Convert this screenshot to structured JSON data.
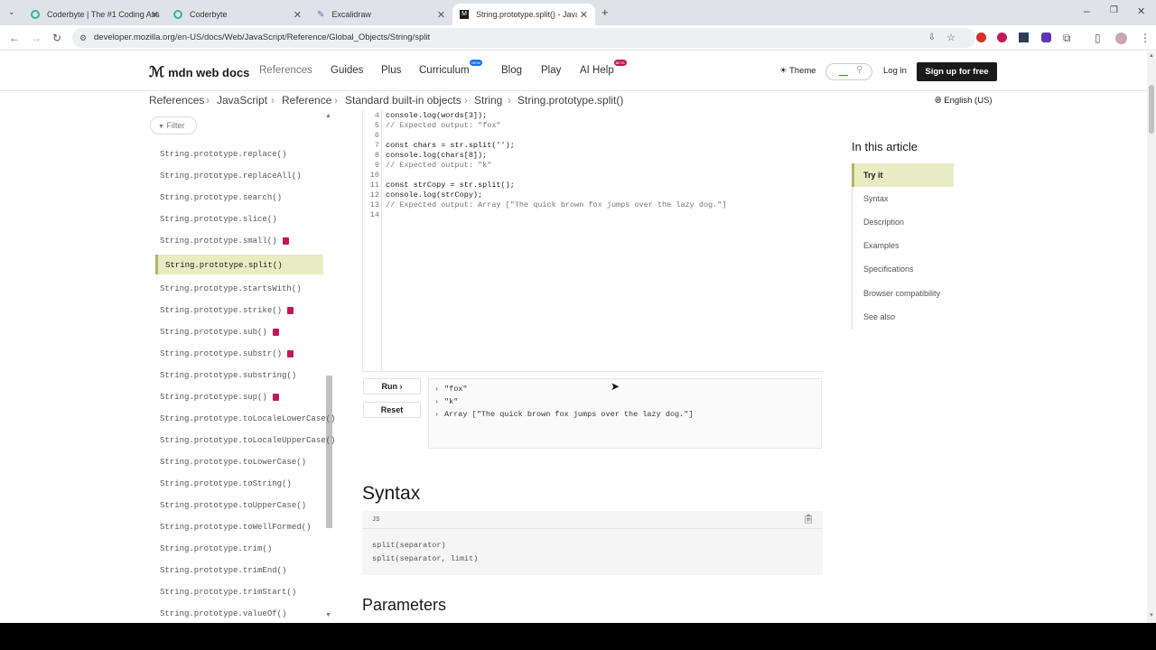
{
  "browser": {
    "tabs": [
      {
        "title": "Coderbyte | The #1 Coding Ass",
        "active": false
      },
      {
        "title": "Coderbyte",
        "active": false
      },
      {
        "title": "Excalidraw",
        "active": false
      },
      {
        "title": "String.prototype.split() - JavaSc",
        "active": true
      }
    ],
    "url": "developer.mozilla.org/en-US/docs/Web/JavaScript/Reference/Global_Objects/String/split"
  },
  "header": {
    "logo": "mdn web docs",
    "nav": [
      "References",
      "Guides",
      "Plus",
      "Curriculum",
      "Blog",
      "Play",
      "AI Help"
    ],
    "curriculum_badge": "NEW",
    "ai_badge": "BETA",
    "theme": "Theme",
    "login": "Log in",
    "signup": "Sign up for free"
  },
  "breadcrumbs": [
    "References",
    "JavaScript",
    "Reference",
    "Standard built-in objects",
    "String",
    "String.prototype.split()"
  ],
  "language": "English (US)",
  "sidebar": {
    "filter": "Filter",
    "items": [
      {
        "label": "String.prototype.replace()",
        "deprecated": false,
        "active": false
      },
      {
        "label": "String.prototype.replaceAll()",
        "deprecated": false,
        "active": false
      },
      {
        "label": "String.prototype.search()",
        "deprecated": false,
        "active": false
      },
      {
        "label": "String.prototype.slice()",
        "deprecated": false,
        "active": false
      },
      {
        "label": "String.prototype.small()",
        "deprecated": true,
        "active": false
      },
      {
        "label": "String.prototype.split()",
        "deprecated": false,
        "active": true
      },
      {
        "label": "String.prototype.startsWith()",
        "deprecated": false,
        "active": false
      },
      {
        "label": "String.prototype.strike()",
        "deprecated": true,
        "active": false
      },
      {
        "label": "String.prototype.sub()",
        "deprecated": true,
        "active": false
      },
      {
        "label": "String.prototype.substr()",
        "deprecated": true,
        "active": false
      },
      {
        "label": "String.prototype.substring()",
        "deprecated": false,
        "active": false
      },
      {
        "label": "String.prototype.sup()",
        "deprecated": true,
        "active": false
      },
      {
        "label": "String.prototype.toLocaleLowerCase()",
        "deprecated": false,
        "active": false
      },
      {
        "label": "String.prototype.toLocaleUpperCase()",
        "deprecated": false,
        "active": false
      },
      {
        "label": "String.prototype.toLowerCase()",
        "deprecated": false,
        "active": false
      },
      {
        "label": "String.prototype.toString()",
        "deprecated": false,
        "active": false
      },
      {
        "label": "String.prototype.toUpperCase()",
        "deprecated": false,
        "active": false
      },
      {
        "label": "String.prototype.toWellFormed()",
        "deprecated": false,
        "active": false
      },
      {
        "label": "String.prototype.trim()",
        "deprecated": false,
        "active": false
      },
      {
        "label": "String.prototype.trimEnd()",
        "deprecated": false,
        "active": false
      },
      {
        "label": "String.prototype.trimStart()",
        "deprecated": false,
        "active": false
      },
      {
        "label": "String.prototype.valueOf()",
        "deprecated": false,
        "active": false
      }
    ]
  },
  "editor": {
    "lines": [
      {
        "n": "4",
        "text": "console.log(words[3]);",
        "comment": false
      },
      {
        "n": "5",
        "text": "// Expected output: \"fox\"",
        "comment": true
      },
      {
        "n": "6",
        "text": "",
        "comment": false
      },
      {
        "n": "7",
        "text": "const chars = str.split('');",
        "comment": false
      },
      {
        "n": "8",
        "text": "console.log(chars[8]);",
        "comment": false
      },
      {
        "n": "9",
        "text": "// Expected output: \"k\"",
        "comment": true
      },
      {
        "n": "10",
        "text": "",
        "comment": false
      },
      {
        "n": "11",
        "text": "const strCopy = str.split();",
        "comment": false
      },
      {
        "n": "12",
        "text": "console.log(strCopy);",
        "comment": false
      },
      {
        "n": "13",
        "text": "// Expected output: Array [\"The quick brown fox jumps over the lazy dog.\"]",
        "comment": true
      },
      {
        "n": "14",
        "text": "",
        "comment": false
      }
    ],
    "run": "Run ›",
    "reset": "Reset",
    "console": [
      "\"fox\"",
      "\"k\"",
      "Array [\"The quick brown fox jumps over the lazy dog.\"]"
    ]
  },
  "syntax": {
    "heading": "Syntax",
    "lang": "JS",
    "lines": [
      "split(separator)",
      "split(separator, limit)"
    ]
  },
  "parameters_heading": "Parameters",
  "toc": {
    "heading": "In this article",
    "items": [
      "Try it",
      "Syntax",
      "Description",
      "Examples",
      "Specifications",
      "Browser compatibility",
      "See also"
    ]
  }
}
